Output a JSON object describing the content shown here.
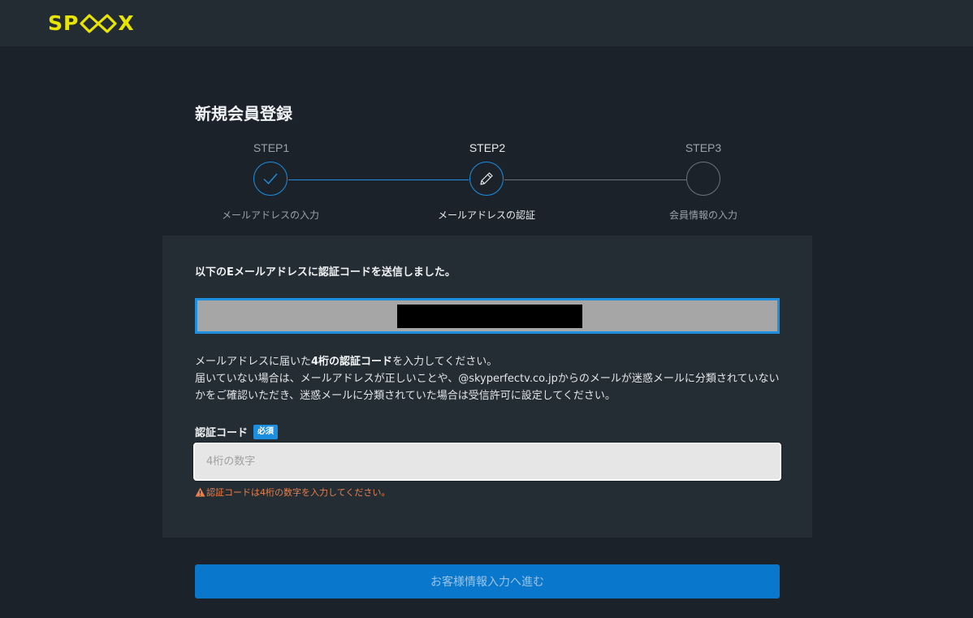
{
  "header": {
    "logo_text": "SPOOX",
    "logo_color": "#e9e500"
  },
  "page_title": "新規会員登録",
  "steps": [
    {
      "label": "STEP1",
      "caption": "メールアドレスの入力",
      "state": "done",
      "icon": "check-icon"
    },
    {
      "label": "STEP2",
      "caption": "メールアドレスの認証",
      "state": "active",
      "icon": "pencil-icon"
    },
    {
      "label": "STEP3",
      "caption": "会員情報の入力",
      "state": "pending",
      "icon": ""
    }
  ],
  "panel": {
    "heading": "以下のEメールアドレスに認証コードを送信しました。",
    "email_value": "",
    "instructions_line1_pre": "メールアドレスに届いた",
    "instructions_line1_bold": "4桁の認証コード",
    "instructions_line1_post": "を入力してください。",
    "instructions_line2": "届いていない場合は、メールアドレスが正しいことや、@skyperfectv.co.jpからのメールが迷惑メールに分類されていないかをご確認いただき、迷惑メールに分類されていた場合は受信許可に設定してください。",
    "field_label": "認証コード",
    "required_badge": "必須",
    "code_input_value": "",
    "code_input_placeholder": "4桁の数字",
    "error_message": "認証コードは4桁の数字を入力してください。"
  },
  "submit_label": "お客様情報入力へ進む",
  "colors": {
    "accent": "#1d8fe0",
    "button": "#0978cc",
    "error": "#ef7e48",
    "background": "#1b2229",
    "panel": "#252d34"
  }
}
